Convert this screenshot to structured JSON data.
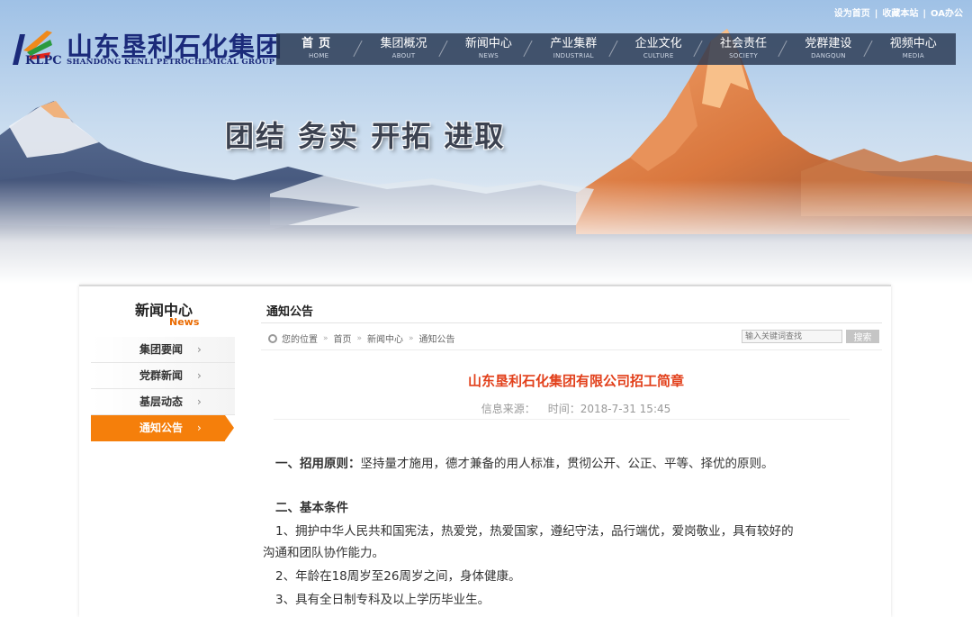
{
  "top_links": [
    "设为首页",
    "收藏本站",
    "OA办公"
  ],
  "logo": {
    "abbr": "KLPC",
    "name_cn": "山东垦利石化集团",
    "name_en": "SHANDONG KENLI PETROCHEMICAL GROUP"
  },
  "nav": [
    {
      "cn": "首页",
      "en": "HOME",
      "active": true
    },
    {
      "cn": "集团概况",
      "en": "ABOUT"
    },
    {
      "cn": "新闻中心",
      "en": "NEWS"
    },
    {
      "cn": "产业集群",
      "en": "INDUSTRIAL"
    },
    {
      "cn": "企业文化",
      "en": "CULTURE"
    },
    {
      "cn": "社会责任",
      "en": "SOCIETY"
    },
    {
      "cn": "党群建设",
      "en": "DANGQUN"
    },
    {
      "cn": "视频中心",
      "en": "MEDIA"
    }
  ],
  "slogan": "团结 务实 开拓 进取",
  "sidebar": {
    "title": "新闻中心",
    "title_en": "News",
    "items": [
      {
        "label": "集团要闻"
      },
      {
        "label": "党群新闻"
      },
      {
        "label": "基层动态"
      },
      {
        "label": "通知公告",
        "active": true
      }
    ],
    "arrow": "›"
  },
  "main": {
    "section_title": "通知公告",
    "breadcrumb": [
      "您的位置",
      "首页",
      "新闻中心",
      "通知公告"
    ],
    "search_placeholder": "输入关键词查找",
    "search_button": "搜索",
    "article_title": "山东垦利石化集团有限公司招工简章",
    "source_label": "信息来源：",
    "time_label": "时间：2018-7-31 15:45"
  },
  "article": {
    "p1_head": "一、招用原则：",
    "p1_body": "坚持量才施用，德才兼备的用人标准，贯彻公开、公正、平等、择优的原则。",
    "p2_head": "二、基本条件",
    "p3_a": "1、拥护中华人民共和国宪法，热爱党，热爱国家，遵纪守法，品行端优，爱岗敬业，具有较好的",
    "p3_b": "沟通和团队协作能力。",
    "p4": "2、年龄在18周岁至26周岁之间，身体健康。",
    "p5": "3、具有全日制专科及以上学历毕业生。"
  },
  "colors": {
    "accent_orange": "#f57f0b",
    "title_red": "#e2401b",
    "brand_blue": "#1b2a7a",
    "nav_bg": "#283750"
  }
}
